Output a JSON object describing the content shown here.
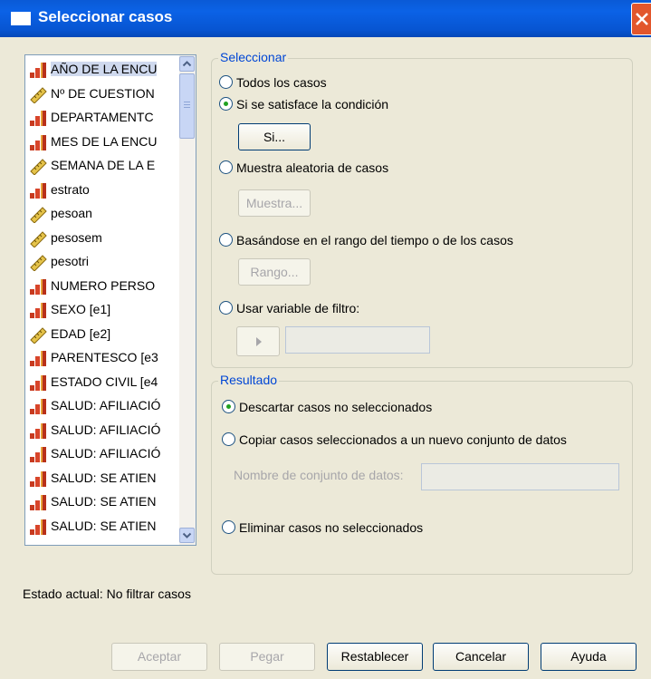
{
  "window": {
    "title": "Seleccionar casos"
  },
  "variables": [
    {
      "label": "AÑO DE LA ENCU",
      "icon": "nominal-icon"
    },
    {
      "label": "Nº DE CUESTION",
      "icon": "scale-icon"
    },
    {
      "label": "DEPARTAMENTC",
      "icon": "nominal-icon"
    },
    {
      "label": "MES DE LA ENCU",
      "icon": "nominal-icon"
    },
    {
      "label": "SEMANA DE LA E",
      "icon": "scale-icon"
    },
    {
      "label": "estrato",
      "icon": "nominal-icon"
    },
    {
      "label": "pesoan",
      "icon": "scale-icon"
    },
    {
      "label": "pesosem",
      "icon": "scale-icon"
    },
    {
      "label": "pesotri",
      "icon": "scale-icon"
    },
    {
      "label": "NUMERO PERSO",
      "icon": "nominal-icon"
    },
    {
      "label": "SEXO [e1]",
      "icon": "nominal-icon"
    },
    {
      "label": "EDAD [e2]",
      "icon": "scale-icon"
    },
    {
      "label": "PARENTESCO [e3",
      "icon": "nominal-icon"
    },
    {
      "label": "ESTADO CIVIL [e4",
      "icon": "nominal-icon"
    },
    {
      "label": "SALUD: AFILIACIÓ",
      "icon": "nominal-icon"
    },
    {
      "label": "SALUD: AFILIACIÓ",
      "icon": "nominal-icon"
    },
    {
      "label": "SALUD: AFILIACIÓ",
      "icon": "nominal-icon"
    },
    {
      "label": "SALUD: SE ATIEN",
      "icon": "nominal-icon"
    },
    {
      "label": "SALUD: SE ATIEN",
      "icon": "nominal-icon"
    },
    {
      "label": "SALUD: SE ATIEN",
      "icon": "nominal-icon"
    }
  ],
  "select_group": {
    "legend": "Seleccionar",
    "options": {
      "all": "Todos los casos",
      "condition": "Si se satisface la condición",
      "random": "Muestra aleatoria de casos",
      "range": "Basándose en el rango del tiempo o de los casos",
      "filter": "Usar variable de filtro:"
    },
    "selected": "condition",
    "buttons": {
      "if": "Si...",
      "sample": "Muestra...",
      "range": "Rango..."
    },
    "filter_value": ""
  },
  "result_group": {
    "legend": "Resultado",
    "options": {
      "discard": "Descartar casos no seleccionados",
      "copy": "Copiar casos seleccionados a un nuevo conjunto de datos",
      "delete": "Eliminar casos no seleccionados"
    },
    "selected": "discard",
    "dataset_name_label": "Nombre de conjunto de datos:",
    "dataset_name_value": ""
  },
  "status": "Estado actual: No filtrar casos",
  "buttons": {
    "ok": "Aceptar",
    "paste": "Pegar",
    "reset": "Restablecer",
    "cancel": "Cancelar",
    "help": "Ayuda"
  },
  "colors": {
    "title_bar": "#0a5ad6",
    "group_legend": "#0046d5",
    "radio_selected": "#21a121",
    "close_button": "#e2562c"
  }
}
